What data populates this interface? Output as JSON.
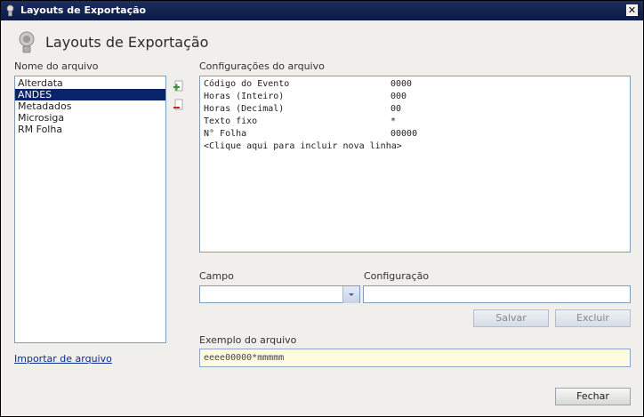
{
  "window": {
    "title": "Layouts de Exportação",
    "close_label": "✕"
  },
  "header": {
    "title": "Layouts de Exportação"
  },
  "files": {
    "label": "Nome do arquivo",
    "items": [
      "Alterdata",
      "ANDES",
      "Metadados",
      "Microsiga",
      "RM Folha"
    ],
    "selected": "ANDES"
  },
  "config": {
    "label": "Configurações do arquivo",
    "rows": [
      {
        "key": "Código do Evento",
        "value": "0000"
      },
      {
        "key": "Horas (Inteiro)",
        "value": "000"
      },
      {
        "key": "Horas (Decimal)",
        "value": "00"
      },
      {
        "key": "Texto fixo",
        "value": "*"
      },
      {
        "key": "N° Folha",
        "value": "00000"
      }
    ],
    "add_line_hint": "<Clique aqui para incluir nova linha>"
  },
  "form": {
    "campo_label": "Campo",
    "campo_value": "",
    "configuracao_label": "Configuração",
    "configuracao_value": "",
    "save_label": "Salvar",
    "delete_label": "Excluir"
  },
  "example": {
    "label": "Exemplo do arquivo",
    "value": "eeee00000*mmmmm"
  },
  "import_link": "Importar de arquivo",
  "close_button": "Fechar"
}
